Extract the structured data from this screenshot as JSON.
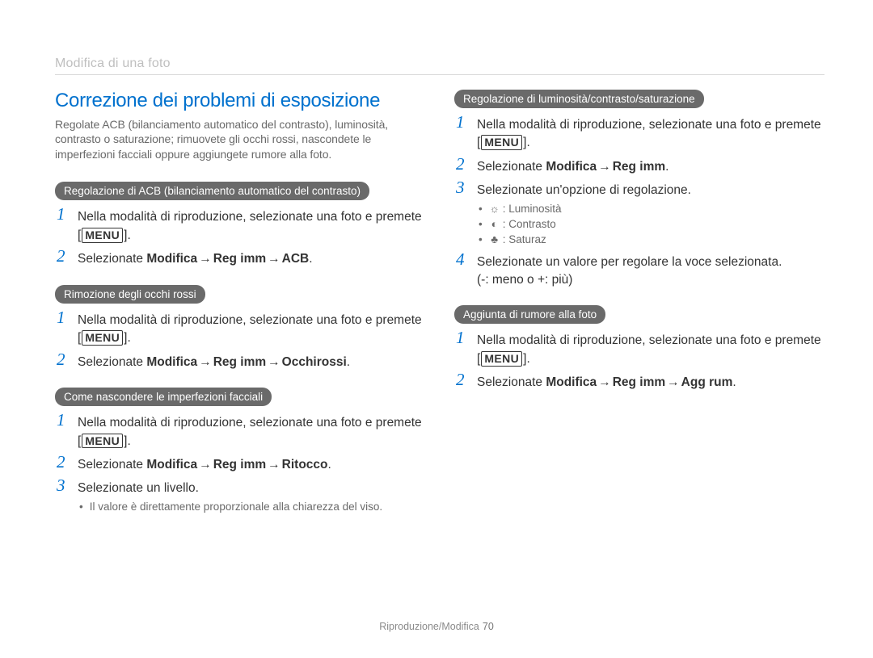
{
  "breadcrumb": "Modifica di una foto",
  "title": "Correzione dei problemi di esposizione",
  "intro": "Regolate ACB (bilanciamento automatico del contrasto), luminosità, contrasto o saturazione; rimuovete gli occhi rossi, nascondete le imperfezioni facciali oppure aggiungete rumore alla foto.",
  "menu_label": "MENU",
  "arrow": "→",
  "acb": {
    "pill": "Regolazione di ACB (bilanciamento automatico del contrasto)",
    "step1_pre": "Nella modalità di riproduzione, selezionate una foto e premete [",
    "step1_post": "].",
    "step2_pre": "Selezionate ",
    "step2_a": "Modifica",
    "step2_b": "Reg imm",
    "step2_c": "ACB",
    "step2_end": "."
  },
  "redeye": {
    "pill": "Rimozione degli occhi rossi",
    "step1_pre": "Nella modalità di riproduzione, selezionate una foto e premete [",
    "step1_post": "].",
    "step2_pre": "Selezionate ",
    "step2_a": "Modifica",
    "step2_b": "Reg imm",
    "step2_c": "Occhirossi",
    "step2_end": "."
  },
  "face": {
    "pill": "Come nascondere le imperfezioni facciali",
    "step1_pre": "Nella modalità di riproduzione, selezionate una foto e premete [",
    "step1_post": "].",
    "step2_pre": "Selezionate ",
    "step2_a": "Modifica",
    "step2_b": "Reg imm",
    "step2_c": "Ritocco",
    "step2_end": ".",
    "step3": "Selezionate un livello.",
    "note": "Il valore è direttamente proporzionale alla chiarezza del viso."
  },
  "bcs": {
    "pill": "Regolazione di luminosità/contrasto/saturazione",
    "step1_pre": "Nella modalità di riproduzione, selezionate una foto e premete [",
    "step1_post": "].",
    "step2_pre": "Selezionate ",
    "step2_a": "Modifica",
    "step2_b": "Reg imm",
    "step2_end": ".",
    "step3": "Selezionate un'opzione di regolazione.",
    "opts": {
      "brightness_icon": "☼",
      "brightness": ": Luminosità",
      "contrast_icon": "◐",
      "contrast": ": Contrasto",
      "saturation_icon": "♣",
      "saturation": ": Saturaz"
    },
    "step4a": "Selezionate un valore per regolare la voce selezionata.",
    "step4b": "(-: meno o +: più)"
  },
  "noise": {
    "pill": "Aggiunta di rumore alla foto",
    "step1_pre": "Nella modalità di riproduzione, selezionate una foto e premete [",
    "step1_post": "].",
    "step2_pre": "Selezionate ",
    "step2_a": "Modifica",
    "step2_b": "Reg imm",
    "step2_c": "Agg rum",
    "step2_end": "."
  },
  "footer": {
    "label": "Riproduzione/Modifica",
    "page": "70"
  }
}
